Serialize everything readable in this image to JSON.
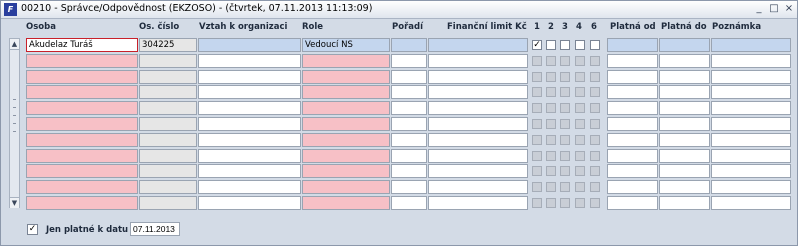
{
  "window": {
    "app_icon": "F",
    "title": "00210 - Správce/Odpovědnost (EKZOSO) - (čtvrtek, 07.11.2013 11:13:09)",
    "minimize": "_",
    "maximize": "□",
    "close": "×"
  },
  "columns": {
    "osoba": "Osoba",
    "os_cislo": "Os. číslo",
    "vztah": "Vztah k organizaci",
    "role": "Role",
    "poradi": "Pořadí",
    "limit": "Finanční limit Kč",
    "c1": "1",
    "c2": "2",
    "c3": "3",
    "c4": "4",
    "c5": "6",
    "platna_od": "Platná od",
    "platna_do": "Platná do",
    "poznamka": "Poznámka"
  },
  "rows": [
    {
      "osoba": "Akudelaz Turáš",
      "os_cislo": "304225",
      "vztah": "",
      "role": "Vedoucí NS",
      "poradi": "",
      "limit": "",
      "checks": [
        true,
        false,
        false,
        false,
        false
      ],
      "platna_od": "",
      "platna_do": "",
      "poznamka": ""
    },
    {
      "osoba": "",
      "os_cislo": "",
      "vztah": "",
      "role": "",
      "poradi": "",
      "limit": "",
      "checks": [
        false,
        false,
        false,
        false,
        false
      ],
      "platna_od": "",
      "platna_do": "",
      "poznamka": ""
    },
    {
      "osoba": "",
      "os_cislo": "",
      "vztah": "",
      "role": "",
      "poradi": "",
      "limit": "",
      "checks": [
        false,
        false,
        false,
        false,
        false
      ],
      "platna_od": "",
      "platna_do": "",
      "poznamka": ""
    },
    {
      "osoba": "",
      "os_cislo": "",
      "vztah": "",
      "role": "",
      "poradi": "",
      "limit": "",
      "checks": [
        false,
        false,
        false,
        false,
        false
      ],
      "platna_od": "",
      "platna_do": "",
      "poznamka": ""
    },
    {
      "osoba": "",
      "os_cislo": "",
      "vztah": "",
      "role": "",
      "poradi": "",
      "limit": "",
      "checks": [
        false,
        false,
        false,
        false,
        false
      ],
      "platna_od": "",
      "platna_do": "",
      "poznamka": ""
    },
    {
      "osoba": "",
      "os_cislo": "",
      "vztah": "",
      "role": "",
      "poradi": "",
      "limit": "",
      "checks": [
        false,
        false,
        false,
        false,
        false
      ],
      "platna_od": "",
      "platna_do": "",
      "poznamka": ""
    },
    {
      "osoba": "",
      "os_cislo": "",
      "vztah": "",
      "role": "",
      "poradi": "",
      "limit": "",
      "checks": [
        false,
        false,
        false,
        false,
        false
      ],
      "platna_od": "",
      "platna_do": "",
      "poznamka": ""
    },
    {
      "osoba": "",
      "os_cislo": "",
      "vztah": "",
      "role": "",
      "poradi": "",
      "limit": "",
      "checks": [
        false,
        false,
        false,
        false,
        false
      ],
      "platna_od": "",
      "platna_do": "",
      "poznamka": ""
    },
    {
      "osoba": "",
      "os_cislo": "",
      "vztah": "",
      "role": "",
      "poradi": "",
      "limit": "",
      "checks": [
        false,
        false,
        false,
        false,
        false
      ],
      "platna_od": "",
      "platna_do": "",
      "poznamka": ""
    },
    {
      "osoba": "",
      "os_cislo": "",
      "vztah": "",
      "role": "",
      "poradi": "",
      "limit": "",
      "checks": [
        false,
        false,
        false,
        false,
        false
      ],
      "platna_od": "",
      "platna_do": "",
      "poznamka": ""
    },
    {
      "osoba": "",
      "os_cislo": "",
      "vztah": "",
      "role": "",
      "poradi": "",
      "limit": "",
      "checks": [
        false,
        false,
        false,
        false,
        false
      ],
      "platna_od": "",
      "platna_do": "",
      "poznamka": ""
    }
  ],
  "scroll": {
    "up": "▲",
    "down": "▼"
  },
  "footer": {
    "checkbox_checked": true,
    "checkbox_mark": "✓",
    "label": "Jen platné k datu",
    "date": "07.11.2013"
  },
  "colors": {
    "required": "#f7c0c6",
    "readonly": "#e6e6e6",
    "current_row": "#c4d6ee",
    "focus_border": "#c8202a"
  }
}
